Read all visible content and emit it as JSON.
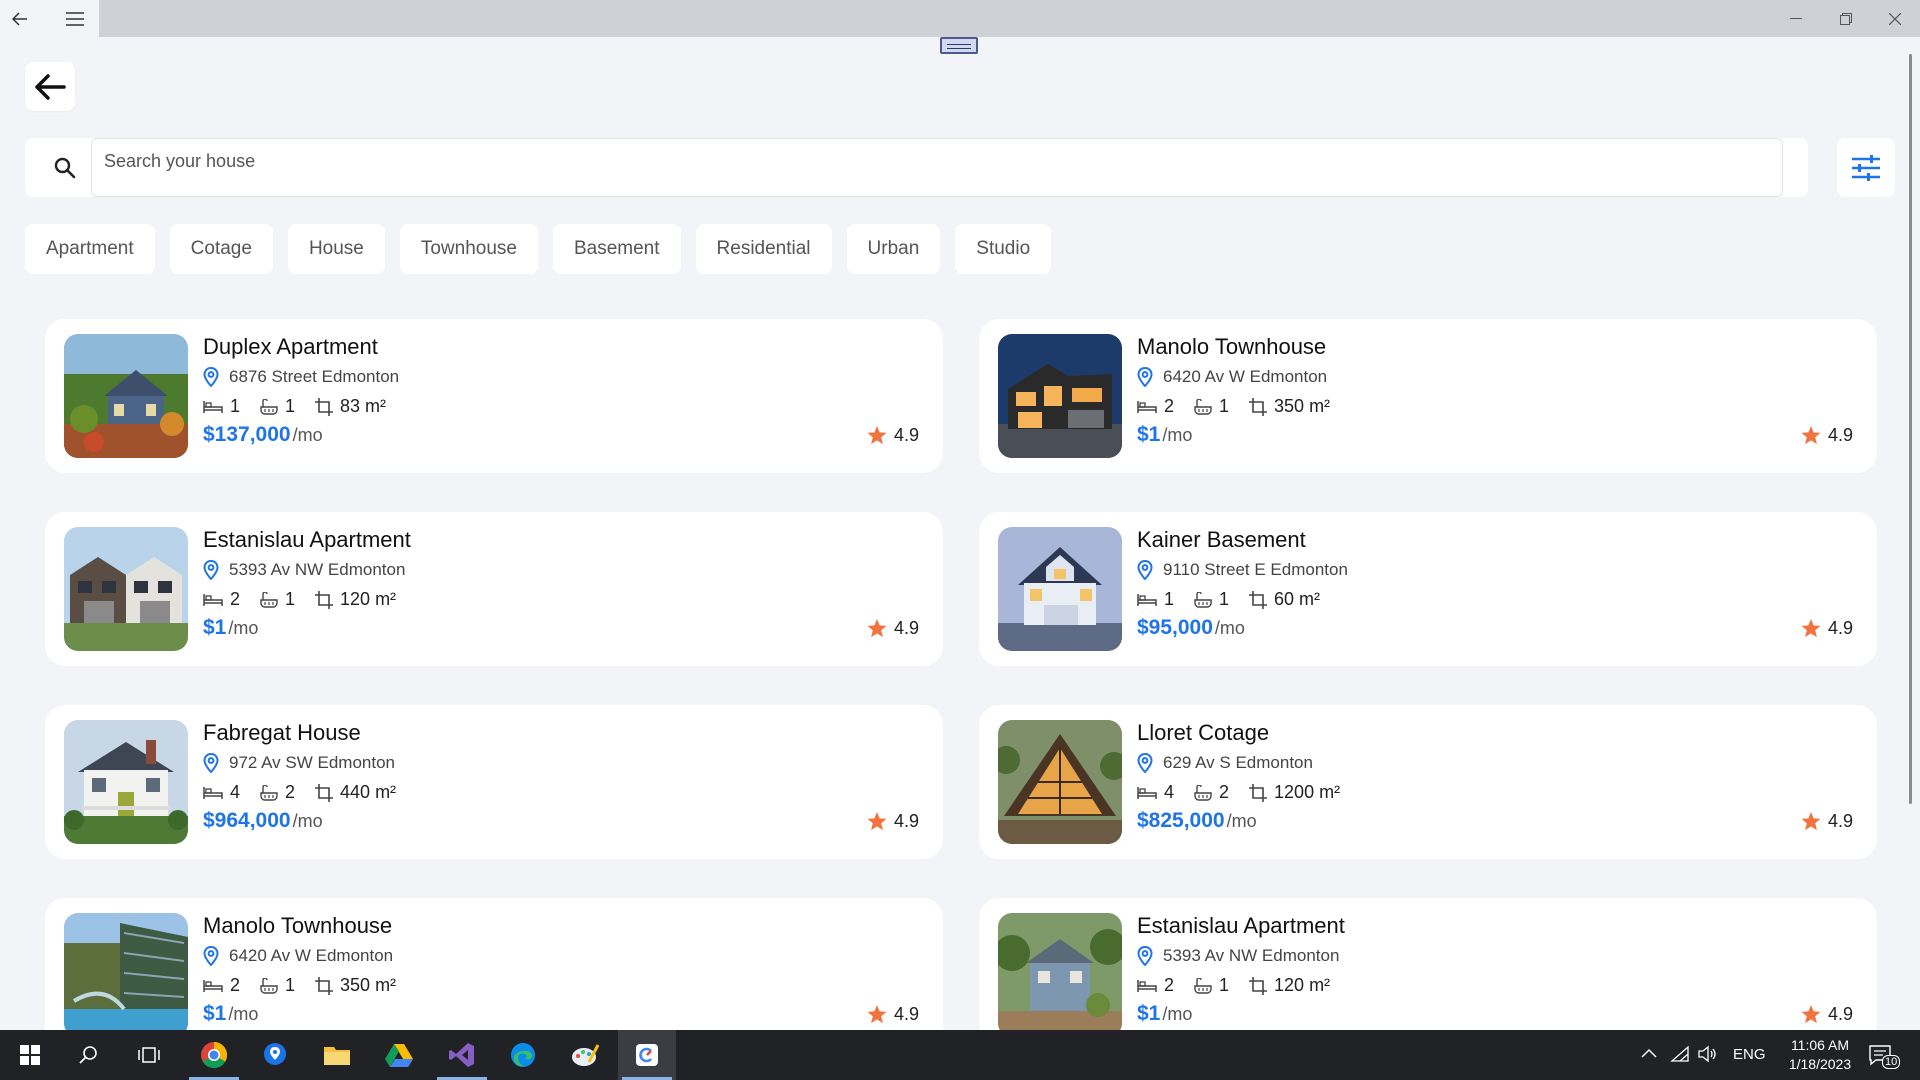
{
  "search": {
    "placeholder": "Search your house",
    "value": ""
  },
  "categories": [
    "Apartment",
    "Cotage",
    "House",
    "Townhouse",
    "Basement",
    "Residential",
    "Urban",
    "Studio"
  ],
  "listings": [
    {
      "title": "Duplex Apartment",
      "address": "6876 Street Edmonton",
      "beds": "1",
      "baths": "1",
      "area": "83 m²",
      "price": "$137,000",
      "per": "/mo",
      "rating": "4.9"
    },
    {
      "title": "Manolo Townhouse",
      "address": "6420 Av W Edmonton",
      "beds": "2",
      "baths": "1",
      "area": "350 m²",
      "price": "$1",
      "per": "/mo",
      "rating": "4.9"
    },
    {
      "title": "Estanislau Apartment",
      "address": "5393 Av NW Edmonton",
      "beds": "2",
      "baths": "1",
      "area": "120 m²",
      "price": "$1",
      "per": "/mo",
      "rating": "4.9"
    },
    {
      "title": "Kainer Basement",
      "address": "9110 Street E Edmonton",
      "beds": "1",
      "baths": "1",
      "area": "60 m²",
      "price": "$95,000",
      "per": "/mo",
      "rating": "4.9"
    },
    {
      "title": "Fabregat House",
      "address": "972 Av SW Edmonton",
      "beds": "4",
      "baths": "2",
      "area": "440 m²",
      "price": "$964,000",
      "per": "/mo",
      "rating": "4.9"
    },
    {
      "title": "Lloret Cotage",
      "address": "629 Av S Edmonton",
      "beds": "4",
      "baths": "2",
      "area": "1200 m²",
      "price": "$825,000",
      "per": "/mo",
      "rating": "4.9"
    },
    {
      "title": "Manolo Townhouse",
      "address": "6420 Av W Edmonton",
      "beds": "2",
      "baths": "1",
      "area": "350 m²",
      "price": "$1",
      "per": "/mo",
      "rating": "4.9"
    },
    {
      "title": "Estanislau Apartment",
      "address": "5393 Av NW Edmonton",
      "beds": "2",
      "baths": "1",
      "area": "120 m²",
      "price": "$1",
      "per": "/mo",
      "rating": "4.9"
    }
  ],
  "taskbar": {
    "apps": [
      "start-icon",
      "search-icon",
      "task-view-icon",
      "chrome-icon",
      "maps-icon",
      "file-explorer-icon",
      "google-drive-icon",
      "visual-studio-icon",
      "edge-icon",
      "paint-icon",
      "app-icon"
    ],
    "language": "ENG",
    "time": "11:06 AM",
    "date": "1/18/2023",
    "notifications": "10"
  },
  "colors": {
    "accent": "#1e74e8",
    "star": "#f0743e",
    "background": "#f3f4f8"
  }
}
